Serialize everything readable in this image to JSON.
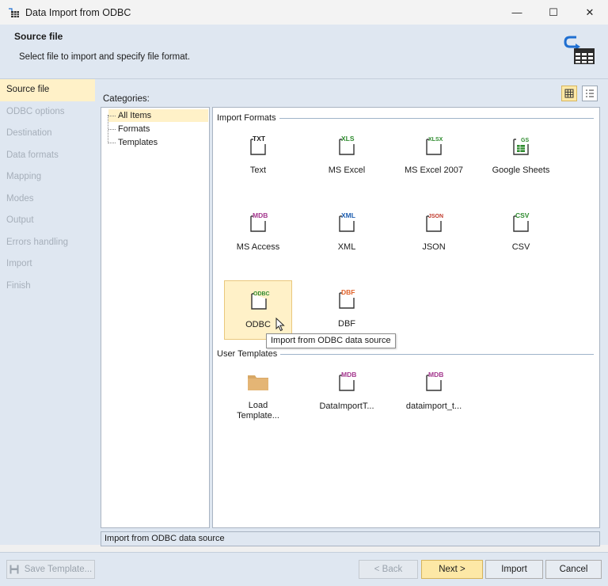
{
  "window": {
    "title": "Data Import from ODBC",
    "minimize": "—",
    "maximize": "☐",
    "close": "✕"
  },
  "header": {
    "title": "Source file",
    "subtitle": "Select file to import and specify file format."
  },
  "nav": {
    "items": [
      "Source file",
      "ODBC options",
      "Destination",
      "Data formats",
      "Mapping",
      "Modes",
      "Output",
      "Errors handling",
      "Import",
      "Finish"
    ],
    "active_index": 0
  },
  "categories": {
    "label": "Categories:",
    "items": [
      "All Items",
      "Formats",
      "Templates"
    ],
    "selected": "All Items"
  },
  "gallery": {
    "import_formats_header": "Import Formats",
    "formats": [
      {
        "badge": "TXT",
        "label": "Text",
        "color": "#1b1b1b",
        "icon": "txt-file-icon"
      },
      {
        "badge": "XLS",
        "label": "MS Excel",
        "color": "#2e8b2e",
        "icon": "xls-file-icon"
      },
      {
        "badge": "XLSX",
        "label": "MS Excel 2007",
        "color": "#2e8b2e",
        "icon": "xlsx-file-icon"
      },
      {
        "badge": "GS",
        "label": "Google Sheets",
        "color": "#2e8b2e",
        "icon": "google-sheets-file-icon"
      },
      {
        "badge": "MDB",
        "label": "MS Access",
        "color": "#a4378e",
        "icon": "mdb-file-icon"
      },
      {
        "badge": "XML",
        "label": "XML",
        "color": "#1f5fb0",
        "icon": "xml-file-icon"
      },
      {
        "badge": "JSON",
        "label": "JSON",
        "color": "#c0392b",
        "icon": "json-file-icon"
      },
      {
        "badge": "CSV",
        "label": "CSV",
        "color": "#2e8b2e",
        "icon": "csv-file-icon"
      },
      {
        "badge": "ODBC",
        "label": "ODBC",
        "color": "#2e8b2e",
        "icon": "odbc-file-icon"
      },
      {
        "badge": "DBF",
        "label": "DBF",
        "color": "#e0622a",
        "icon": "dbf-file-icon"
      }
    ],
    "selected_format": "ODBC",
    "user_templates_header": "User Templates",
    "templates": [
      {
        "label": "Load Template...",
        "icon": "folder-icon"
      },
      {
        "badge": "MDB",
        "label": "DataImportT...",
        "color": "#a4378e",
        "icon": "mdb-file-icon"
      },
      {
        "badge": "MDB",
        "label": "dataimport_t...",
        "color": "#a4378e",
        "icon": "mdb-file-icon"
      }
    ],
    "tooltip": "Import from ODBC data source"
  },
  "status": "Import from ODBC data source",
  "footer": {
    "save_template": "Save Template...",
    "back": "< Back",
    "next": "Next >",
    "import": "Import",
    "cancel": "Cancel"
  }
}
